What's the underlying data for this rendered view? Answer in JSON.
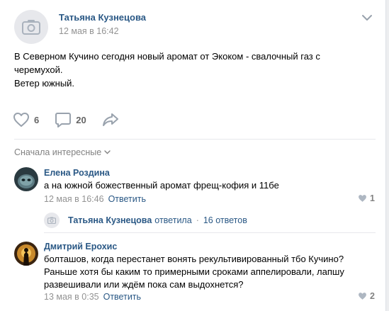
{
  "post": {
    "author": "Татьяна Кузнецова",
    "date": "12 мая в 16:42",
    "text_lines": [
      "В Северном Кучино сегодня новый аромат от Экоком - свалочный газ с",
      "черемухой.",
      "Ветер южный."
    ],
    "likes": "6",
    "comments": "20"
  },
  "sort_label": "Сначала интересные",
  "comments": [
    {
      "author": "Елена Роздина",
      "text": "а на южной божественный аромат фрещ-кофия и 11бе",
      "date": "12 мая в 16:46",
      "reply_label": "Ответить",
      "likes": "1"
    },
    {
      "author": "Дмитрий Ерохис",
      "text_lines": [
        "болташов, когда перестанет вонять рекультивированный тбо Кучино?",
        "Раньше хотя бы каким то примерными сроками аппелировали, лапшу",
        "развешивали или ждём пока сам выдохнется?"
      ],
      "date": "13 мая в 0:35",
      "reply_label": "Ответить",
      "likes": "2"
    }
  ],
  "thread": {
    "author": "Татьяна Кузнецова",
    "verb": "ответила",
    "sep": "·",
    "count": "16 ответов"
  },
  "colors": {
    "link": "#2a5885",
    "meta": "#939393",
    "icon": "#99a2ad"
  }
}
